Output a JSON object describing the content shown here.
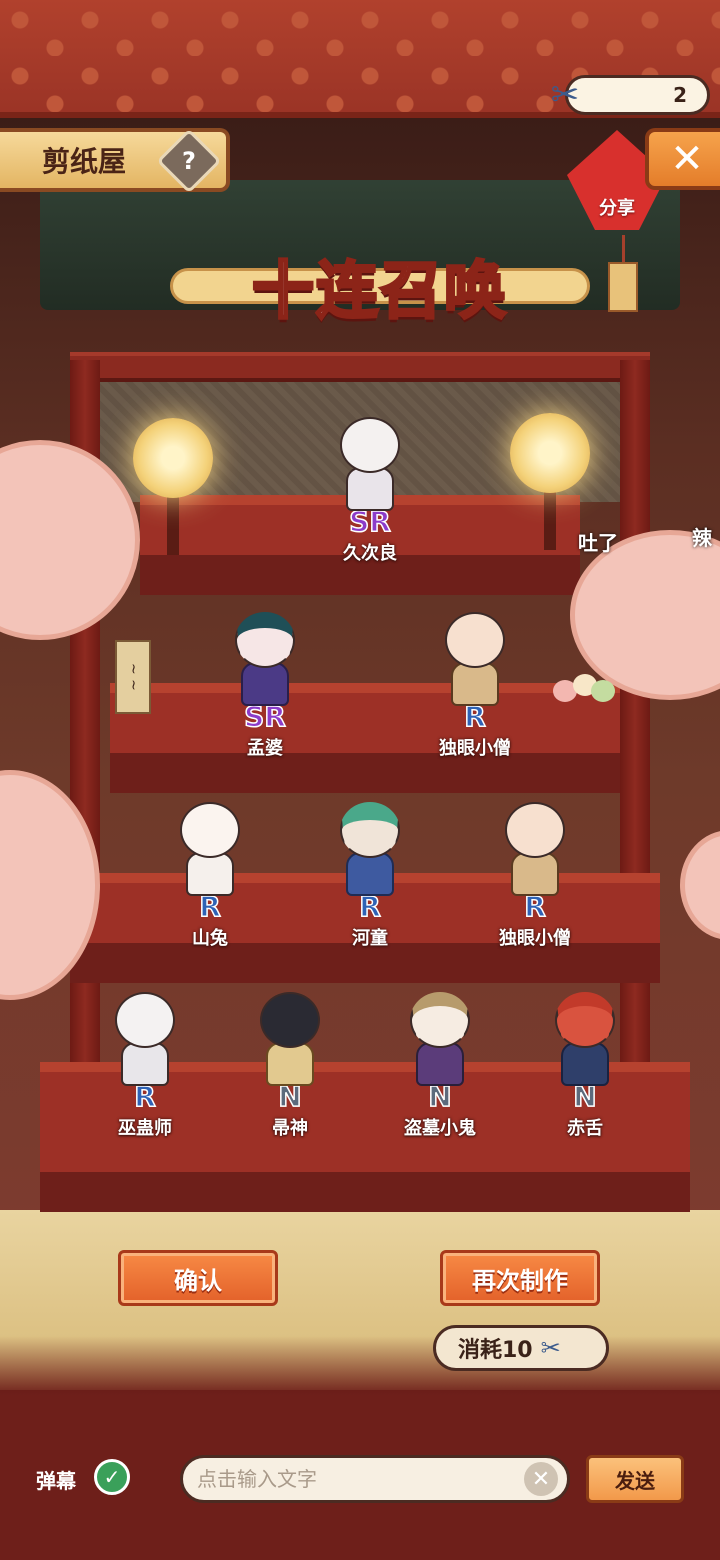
{
  "header": {
    "title": "剪纸屋",
    "help_symbol": "?",
    "counter": "2",
    "close_symbol": "✕",
    "share_label": "分享",
    "main_title": "十连召唤"
  },
  "danmaku": [
    "吐了",
    "辣"
  ],
  "summons": [
    {
      "name": "久次良",
      "rarity": "SR"
    },
    {
      "name": "孟婆",
      "rarity": "SR"
    },
    {
      "name": "独眼小僧",
      "rarity": "R"
    },
    {
      "name": "山兔",
      "rarity": "R"
    },
    {
      "name": "河童",
      "rarity": "R"
    },
    {
      "name": "独眼小僧",
      "rarity": "R"
    },
    {
      "name": "巫蛊师",
      "rarity": "R"
    },
    {
      "name": "帚神",
      "rarity": "N"
    },
    {
      "name": "盗墓小鬼",
      "rarity": "N"
    },
    {
      "name": "赤舌",
      "rarity": "N"
    }
  ],
  "actions": {
    "confirm_label": "确认",
    "again_label": "再次制作",
    "cost_label": "消耗10"
  },
  "bottom_bar": {
    "danmaku_label": "弹幕",
    "check_symbol": "✓",
    "input_placeholder": "点击输入文字",
    "clear_symbol": "✕",
    "send_label": "发送"
  },
  "colors": {
    "accent_orange": "#e3612a",
    "sr_purple": "#8c3cc9",
    "r_blue": "#2f62b5",
    "n_gray": "#5c6a7c",
    "stair_red": "#9d3026"
  }
}
